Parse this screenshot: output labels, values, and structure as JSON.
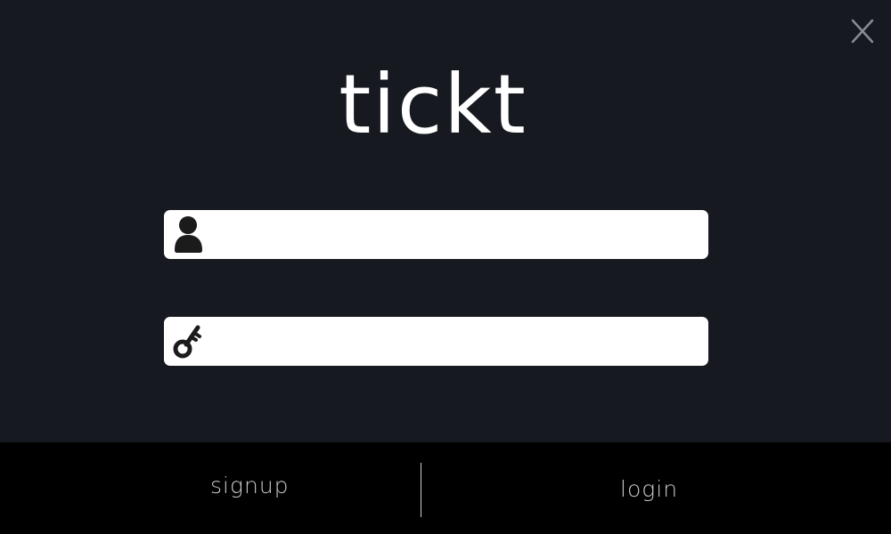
{
  "app": {
    "logo_text": "tickt"
  },
  "window": {
    "close_icon": "close-icon"
  },
  "form": {
    "username": {
      "icon": "user-icon",
      "value": "",
      "placeholder": ""
    },
    "password": {
      "icon": "key-icon",
      "value": "",
      "placeholder": ""
    }
  },
  "footer": {
    "signup_label": "signup",
    "login_label": "login"
  },
  "colors": {
    "background": "#171921",
    "footer_background": "#000000",
    "field_background": "#ffffff",
    "footer_text": "#c9c9c9",
    "logo_text": "#ffffff"
  }
}
